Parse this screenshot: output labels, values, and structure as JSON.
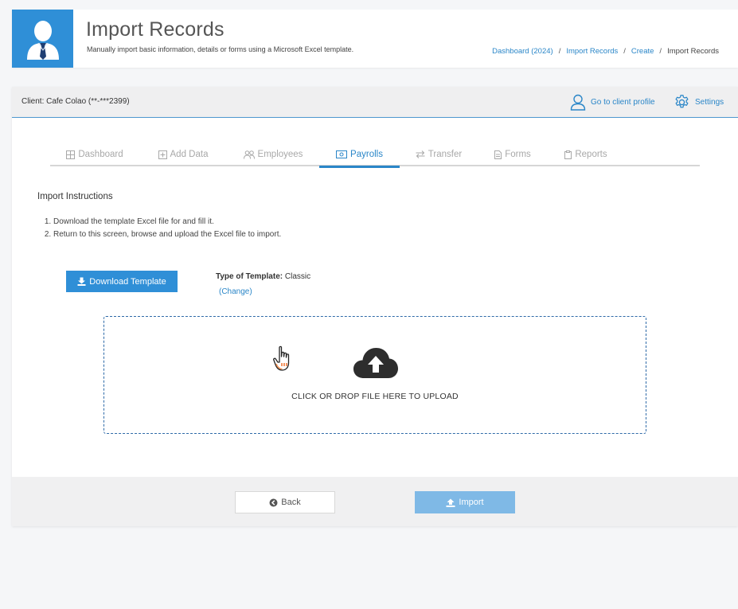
{
  "header": {
    "title": "Import Records",
    "subtitle": "Manually import basic information, details or forms using a Microsoft Excel template.",
    "avatar_icon": "user-avatar-icon",
    "breadcrumb": [
      {
        "label": "Dashboard (2024)",
        "link": true
      },
      {
        "label": "Import Records",
        "link": true
      },
      {
        "label": "Create",
        "link": true
      },
      {
        "label": "Import Records",
        "link": false
      }
    ]
  },
  "client_bar": {
    "client_label": "Client: Cafe Colao (**-***2399)",
    "profile_label": "Go to client profile",
    "settings_label": "Settings"
  },
  "tabs": [
    {
      "label": "Dashboard",
      "icon": "grid-icon",
      "active": false
    },
    {
      "label": "Add Data",
      "icon": "plus-square-icon",
      "active": false
    },
    {
      "label": "Employees",
      "icon": "users-icon",
      "active": false
    },
    {
      "label": "Payrolls",
      "icon": "money-icon",
      "active": true
    },
    {
      "label": "Transfer",
      "icon": "transfer-icon",
      "active": false
    },
    {
      "label": "Forms",
      "icon": "file-icon",
      "active": false
    },
    {
      "label": "Reports",
      "icon": "clipboard-icon",
      "active": false
    }
  ],
  "instructions": {
    "title": "Import Instructions",
    "steps": [
      "Download the template Excel file for and fill it.",
      "Return to this screen, browse and upload the Excel file to import."
    ]
  },
  "template": {
    "download_label": "Download Template",
    "type_label": "Type of Template:",
    "type_value": "Classic",
    "change_label": "(Change)"
  },
  "upload": {
    "text": "CLICK OR DROP FILE HERE TO UPLOAD"
  },
  "footer": {
    "back_label": "Back",
    "import_label": "Import"
  },
  "colors": {
    "primary": "#2f8fd7",
    "link": "#2a86c8",
    "import_disabled": "#7fb9e6"
  }
}
